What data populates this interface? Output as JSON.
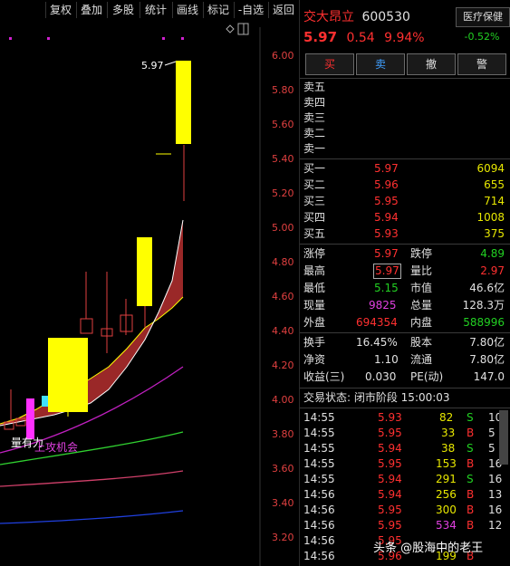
{
  "toolbar": {
    "items": [
      "复权",
      "叠加",
      "多股",
      "统计",
      "画线",
      "标记",
      "-自选",
      "返回"
    ]
  },
  "chart": {
    "y_ticks": [
      "6.00",
      "5.80",
      "5.60",
      "5.40",
      "5.20",
      "5.00",
      "4.80",
      "4.60",
      "4.40",
      "4.20",
      "4.00",
      "3.80",
      "3.60",
      "3.40",
      "3.20"
    ],
    "high_label": "5.97",
    "annotation_volume": "量有力",
    "annotation_signal": "上攻机会"
  },
  "stock": {
    "name": "交大昂立",
    "code": "600530",
    "price": "5.97",
    "change": "0.54",
    "change_pct": "9.94%",
    "sector": "医疗保健",
    "sector_pct": "-0.52%"
  },
  "buttons": {
    "buy": "买",
    "sell": "卖",
    "cancel": "撤",
    "alert": "警"
  },
  "sell_book": [
    {
      "label": "卖五",
      "price": "",
      "vol": ""
    },
    {
      "label": "卖四",
      "price": "",
      "vol": ""
    },
    {
      "label": "卖三",
      "price": "",
      "vol": ""
    },
    {
      "label": "卖二",
      "price": "",
      "vol": ""
    },
    {
      "label": "卖一",
      "price": "",
      "vol": ""
    }
  ],
  "buy_book": [
    {
      "label": "买一",
      "price": "5.97",
      "vol": "6094"
    },
    {
      "label": "买二",
      "price": "5.96",
      "vol": "655"
    },
    {
      "label": "买三",
      "price": "5.95",
      "vol": "714"
    },
    {
      "label": "买四",
      "price": "5.94",
      "vol": "1008"
    },
    {
      "label": "买五",
      "price": "5.93",
      "vol": "375"
    }
  ],
  "stats": {
    "limit_up_label": "涨停",
    "limit_up": "5.97",
    "limit_down_label": "跌停",
    "limit_down": "4.89",
    "high_label": "最高",
    "high": "5.97",
    "vol_ratio_label": "量比",
    "vol_ratio": "2.97",
    "low_label": "最低",
    "low": "5.15",
    "mkt_cap_label": "市值",
    "mkt_cap": "46.6亿",
    "last_vol_label": "现量",
    "last_vol": "9825",
    "total_vol_label": "总量",
    "total_vol": "128.3万",
    "outer_label": "外盘",
    "outer": "694354",
    "inner_label": "内盘",
    "inner": "588996",
    "turnover_label": "换手",
    "turnover": "16.45%",
    "shares_label": "股本",
    "shares": "7.80亿",
    "pb_label": "净资",
    "pb": "1.10",
    "float_label": "流通",
    "float": "7.80亿",
    "eps_label": "收益(三)",
    "eps": "0.030",
    "pe_label": "PE(动)",
    "pe": "147.0"
  },
  "trade_status": "交易状态: 闭市阶段 15:00:03",
  "ticks": [
    {
      "time": "14:55",
      "price": "5.93",
      "vol": "82",
      "side": "S",
      "n": "10"
    },
    {
      "time": "14:55",
      "price": "5.95",
      "vol": "33",
      "side": "B",
      "n": "5"
    },
    {
      "time": "14:55",
      "price": "5.94",
      "vol": "38",
      "side": "S",
      "n": "5"
    },
    {
      "time": "14:55",
      "price": "5.95",
      "vol": "153",
      "side": "B",
      "n": "16"
    },
    {
      "time": "14:55",
      "price": "5.94",
      "vol": "291",
      "side": "S",
      "n": "16"
    },
    {
      "time": "14:56",
      "price": "5.94",
      "vol": "256",
      "side": "B",
      "n": "13"
    },
    {
      "time": "14:56",
      "price": "5.95",
      "vol": "300",
      "side": "B",
      "n": "16"
    },
    {
      "time": "14:56",
      "price": "5.95",
      "vol": "534",
      "side": "B",
      "n": "12"
    },
    {
      "time": "14:56",
      "price": "5.95",
      "vol": "",
      "side": "",
      "n": ""
    },
    {
      "time": "14:56",
      "price": "5.96",
      "vol": "199",
      "side": "B",
      "n": ""
    }
  ],
  "watermark": "头条 @股海中的老王",
  "colors": {
    "up": "#ff3030",
    "down": "#22d022",
    "candle_up": "#ffff00",
    "axis": "#e04040"
  }
}
